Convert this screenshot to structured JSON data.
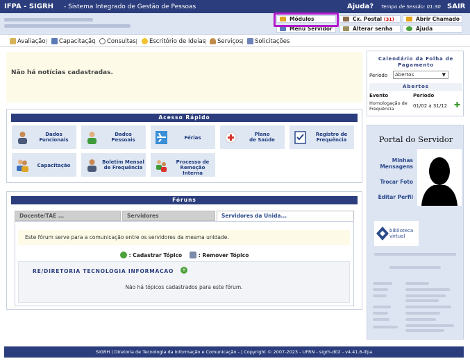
{
  "header": {
    "brand": "IFPA - SIGRH",
    "subtitle": "- Sistema Integrado de Gestão de Pessoas",
    "help": "Ajuda?",
    "session_label": "Tempo de Sessão: 01:30",
    "exit": "SAIR"
  },
  "quick_links": {
    "modulos": "Módulos",
    "menu_servidor": "Menu Servidor",
    "cx_postal": "Cx. Postal",
    "cx_postal_count": "(31)",
    "alterar_senha": "Alterar senha",
    "abrir_chamado": "Abrir Chamado",
    "ajuda": "Ajuda"
  },
  "menu": {
    "items": [
      "Avaliação",
      "Capacitação",
      "Consultas",
      "Escritório de Ideias",
      "Serviços",
      "Solicitações"
    ],
    "separator": "|"
  },
  "news": {
    "message": "Não há notícias cadastradas."
  },
  "acesso_rapido": {
    "title": "Acesso Rápido",
    "tiles": [
      [
        "Dados",
        "Funcionais"
      ],
      [
        "Dados",
        "Pessoais"
      ],
      [
        "Férias"
      ],
      [
        "Plano",
        "de Saúde"
      ],
      [
        "Registro de",
        "Frequência"
      ],
      [
        "Capacitação"
      ],
      [
        "Boletim Mensal",
        "de Frequência"
      ],
      [
        "Processo de",
        "Remoção Interna"
      ]
    ]
  },
  "foruns": {
    "title": "Fóruns",
    "tabs": [
      "Docente/TAE ...",
      "Servidores",
      "Servidores da Unida..."
    ],
    "info": "Este fórum serve para a comunicação entre os servidores da mesma unidade.",
    "actions": {
      "cadastrar": ": Cadastrar Tópico",
      "remover": ": Remover Tópico"
    },
    "section_title": "RE/DIRETORIA TECNOLOGIA INFORMACAO",
    "empty": "Não há tópicos cadastrados para este fórum."
  },
  "calendario": {
    "title": "Calendário da Folha de Pagamento",
    "periodo_label": "Período",
    "periodo_value": "Abertos",
    "abertos_header": "Abertos",
    "col_evento": "Evento",
    "col_periodo": "Período",
    "evento": "Homologação de Frequência",
    "periodo": "01/02 a 31/12"
  },
  "portal": {
    "title": "Portal do Servidor",
    "links": {
      "mensagens": "Minhas Mensagens",
      "foto": "Trocar Foto",
      "perfil": "Editar Perfil"
    },
    "logo_line1": "biblioteca",
    "logo_line2": "virtual"
  },
  "footer": {
    "text": "SIGRH | Diretoria de Tecnologia da Informação e Comunicação - | Copyright © 2007-2023 - UFRN - sigrh-d02 - v4.41.6-ifpa"
  },
  "colors": {
    "navy": "#2b3d7c",
    "light_blue": "#dde5f3",
    "cream": "#fdfbe8",
    "highlight": "#b31acb"
  }
}
